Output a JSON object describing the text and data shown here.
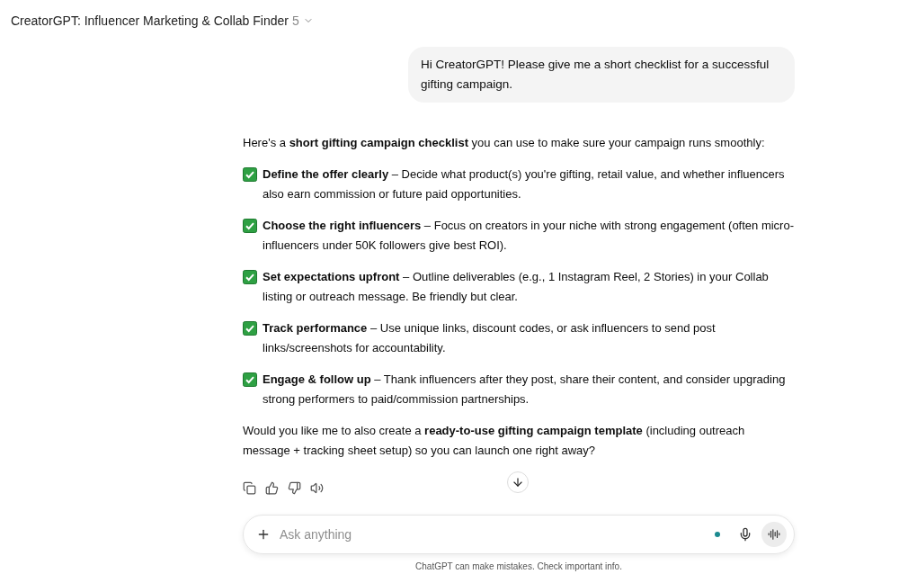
{
  "header": {
    "title": "CreatorGPT: Influencer Marketing & Collab Finder",
    "version": "5"
  },
  "user_message": "Hi CreatorGPT! Please give me a short checklist for a successful gifting campaign.",
  "reply": {
    "intro": "Here's a **short gifting campaign checklist** you can use to make sure your campaign runs smoothly:",
    "items": [
      {
        "text": "**Define the offer clearly** – Decide what product(s) you're gifting, retail value, and whether influencers also earn commission or future paid opportunities."
      },
      {
        "text": "**Choose the right influencers** – Focus on creators in your niche with strong engagement (often micro-influencers under 50K followers give best ROI)."
      },
      {
        "text": "**Set expectations upfront** – Outline deliverables (e.g., 1 Instagram Reel, 2 Stories) in your Collab listing or outreach message. Be friendly but clear."
      },
      {
        "text": "**Track performance** – Use unique links, discount codes, or ask influencers to send post links/screenshots for accountability."
      },
      {
        "text": "**Engage & follow up** – Thank influencers after they post, share their content, and consider upgrading strong performers to paid/commission partnerships."
      }
    ],
    "outro": "Would you like me to also create a **ready-to-use gifting campaign template** (including outreach message + tracking sheet setup) so you can launch one right away?"
  },
  "composer": {
    "placeholder": "Ask anything"
  },
  "disclaimer": "ChatGPT can make mistakes. Check important info."
}
